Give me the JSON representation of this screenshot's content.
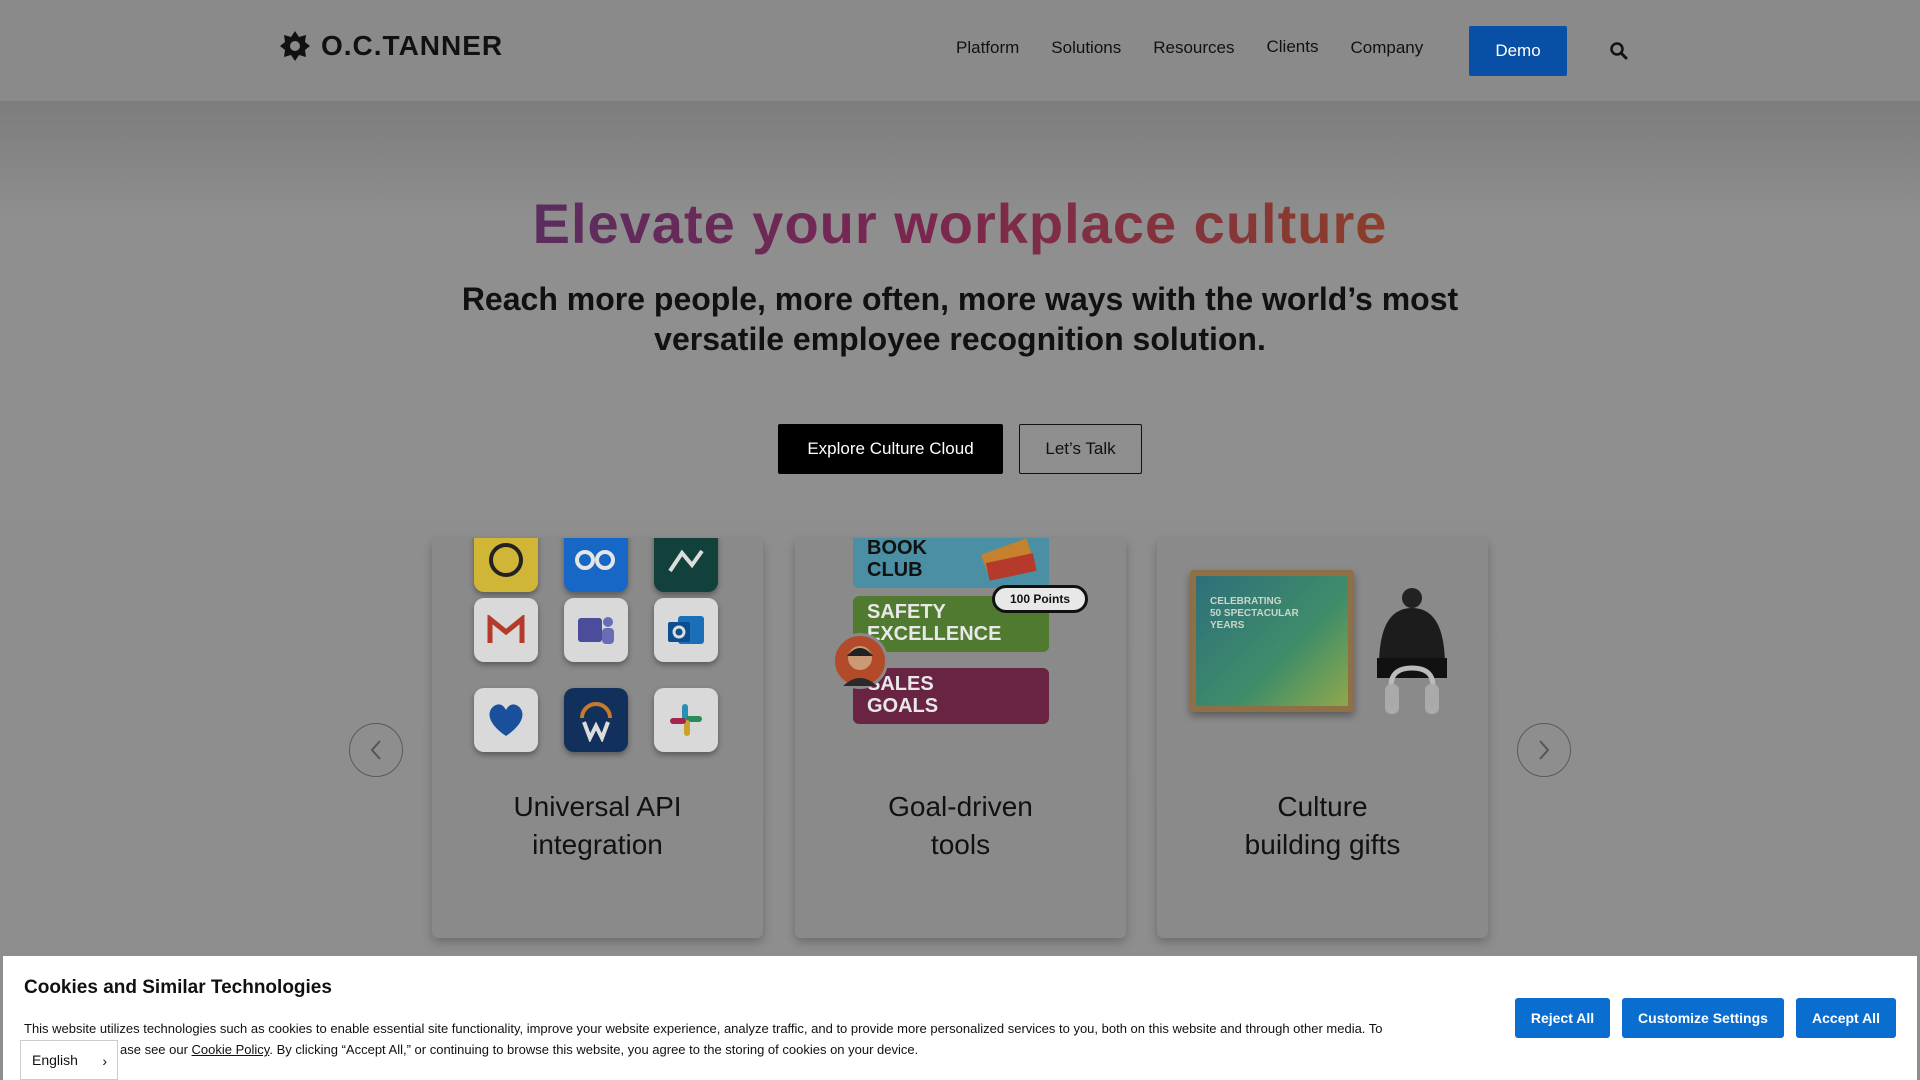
{
  "header": {
    "logo_text": "O.C.TANNER",
    "nav": [
      "Platform",
      "Solutions",
      "Resources",
      "Clients",
      "Company"
    ],
    "demo_label": "Demo"
  },
  "hero": {
    "title": "Elevate your workplace culture",
    "subtitle": "Reach more people, more often, more ways with the world’s most versatile employee recognition solution.",
    "primary_cta": "Explore Culture Cloud",
    "secondary_cta": "Let’s Talk"
  },
  "cards": [
    {
      "title_line1": "Universal API",
      "title_line2": "integration"
    },
    {
      "title_line1": "Goal-driven",
      "title_line2": "tools"
    },
    {
      "title_line1": "Culture",
      "title_line2": "building gifts"
    }
  ],
  "card2": {
    "pill1_line1": "BOOK",
    "pill1_line2": "CLUB",
    "pill2_line1": "SAFETY",
    "pill2_line2": "EXCELLENCE",
    "pill3_line1": "SALES",
    "pill3_line2": "GOALS",
    "points_badge": "100 Points"
  },
  "card3": {
    "poster_line1": "CELEBRATING",
    "poster_line2": "50 SPECTACULAR",
    "poster_line3": "YEARS"
  },
  "cookie": {
    "title": "Cookies and Similar Technologies",
    "text_part1": "This website utilizes technologies such as cookies to enable essential site functionality, improve your website experience, analyze traffic, and to provide more personalized services to you, both on this website and through other media. To",
    "text_part2a": "ase see our ",
    "link": "Cookie Policy",
    "text_part2b": ". By clicking “Accept All,” or continuing to browse this website, you agree to the storing of cookies on your device.",
    "reject": "Reject All",
    "customize": "Customize Settings",
    "accept": "Accept All"
  },
  "language": "English",
  "colors": {
    "demo_blue": "#0a4fa6",
    "cookie_blue": "#0a6ed1"
  }
}
